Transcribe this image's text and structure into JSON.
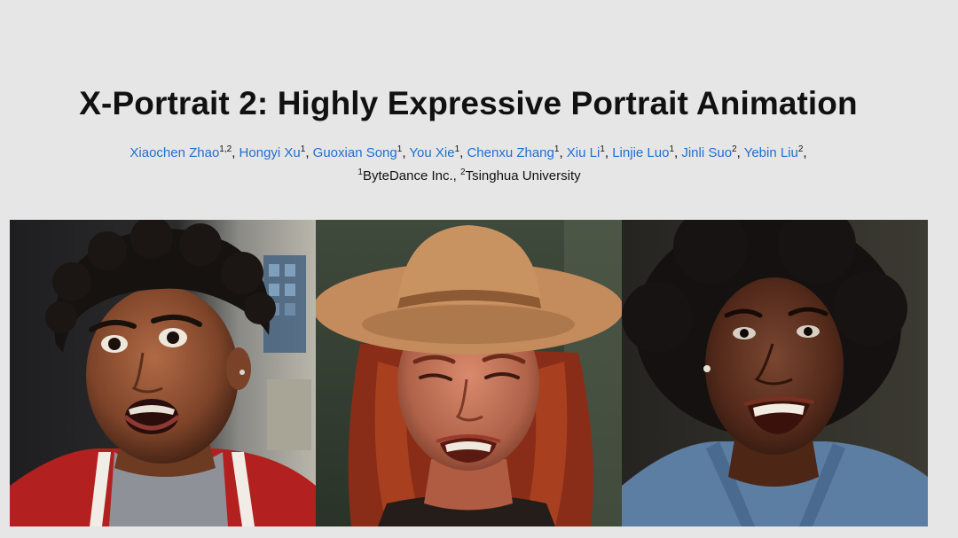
{
  "title": "X-Portrait 2: Highly Expressive Portrait Animation",
  "authors": [
    {
      "name": "Xiaochen Zhao",
      "sup": "1,2",
      "sep": ", "
    },
    {
      "name": "Hongyi Xu",
      "sup": "1",
      "sep": ", "
    },
    {
      "name": "Guoxian Song",
      "sup": "1",
      "sep": ", "
    },
    {
      "name": "You Xie",
      "sup": "1",
      "sep": ", "
    },
    {
      "name": "Chenxu Zhang",
      "sup": "1",
      "sep": ", "
    },
    {
      "name": "Xiu Li",
      "sup": "1",
      "sep": ", "
    },
    {
      "name": "Linjie Luo",
      "sup": "1",
      "sep": ", "
    },
    {
      "name": "Jinli Suo",
      "sup": "2",
      "sep": ", "
    },
    {
      "name": "Yebin Liu",
      "sup": "2",
      "sep": ","
    }
  ],
  "affiliations": [
    {
      "sup": "1",
      "name": "ByteDance Inc.",
      "sep": ", "
    },
    {
      "sup": "2",
      "name": "Tsinghua University",
      "sep": ""
    }
  ],
  "colors": {
    "background": "#e6e6e6",
    "author_link": "#1f6fd1",
    "title_text": "#111111"
  },
  "images": [
    {
      "subject": "young man with curly hair in red jacket, surprised expression"
    },
    {
      "subject": "red-haired woman in tan hat, grimacing expression"
    },
    {
      "subject": "woman with afro in denim shirt, crying smile expression"
    }
  ]
}
